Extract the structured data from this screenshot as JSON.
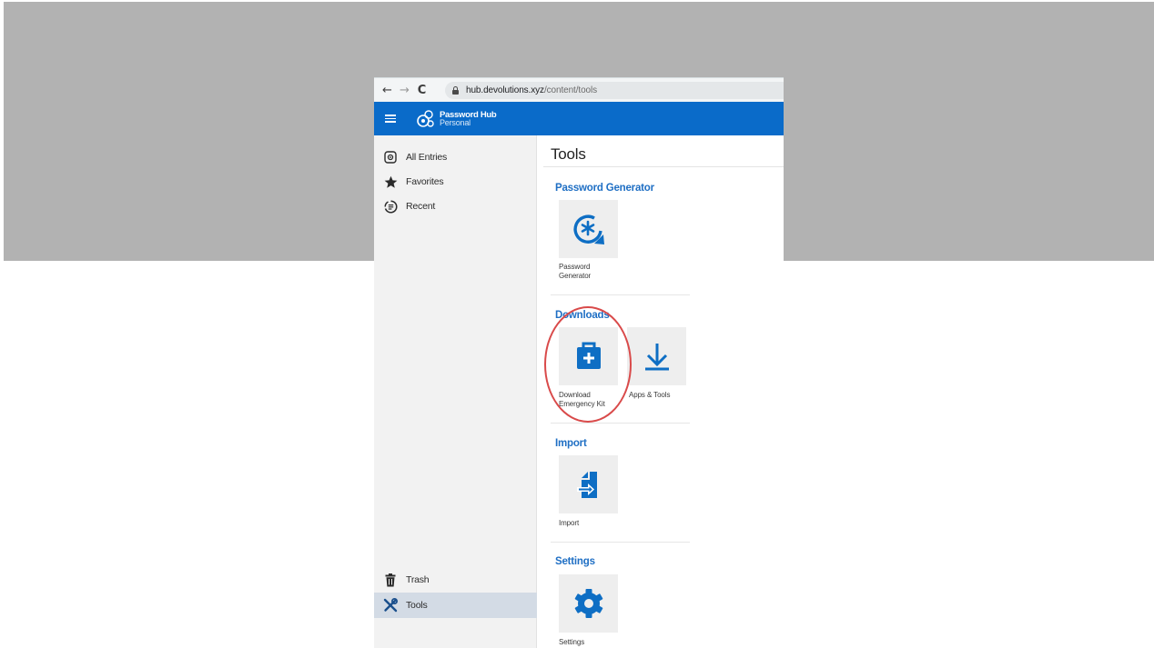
{
  "browser": {
    "back": "←",
    "forward": "→",
    "reload": "C",
    "url_host": "hub.devolutions.xyz",
    "url_path": "/content/tools"
  },
  "header": {
    "brand_name": "Password Hub",
    "brand_edition": "Personal"
  },
  "sidebar": {
    "items": [
      {
        "label": "All Entries",
        "icon": "all-entries-icon"
      },
      {
        "label": "Favorites",
        "icon": "star-icon"
      },
      {
        "label": "Recent",
        "icon": "recent-icon"
      },
      {
        "label": "Trash",
        "icon": "trash-icon"
      },
      {
        "label": "Tools",
        "icon": "tools-icon",
        "active": true
      }
    ]
  },
  "main": {
    "title": "Tools",
    "sections": [
      {
        "title": "Password Generator",
        "tiles": [
          {
            "label_lines": [
              "Password",
              "Generator"
            ],
            "icon": "password-generator-icon"
          }
        ]
      },
      {
        "title": "Downloads",
        "tiles": [
          {
            "label_lines": [
              "Download",
              "Emergency Kit"
            ],
            "icon": "emergency-kit-icon"
          },
          {
            "label_lines": [
              "Apps & Tools"
            ],
            "icon": "download-arrow-icon"
          }
        ]
      },
      {
        "title": "Import",
        "tiles": [
          {
            "label_lines": [
              "Import"
            ],
            "icon": "import-icon"
          }
        ]
      },
      {
        "title": "Settings",
        "tiles": [
          {
            "label_lines": [
              "Settings"
            ],
            "icon": "gear-icon"
          }
        ]
      }
    ]
  },
  "colors": {
    "brand_blue": "#0a6bc9",
    "icon_blue": "#0e6ec4",
    "highlight_red": "#d94a4a",
    "backdrop_gray": "#b2b2b2"
  }
}
